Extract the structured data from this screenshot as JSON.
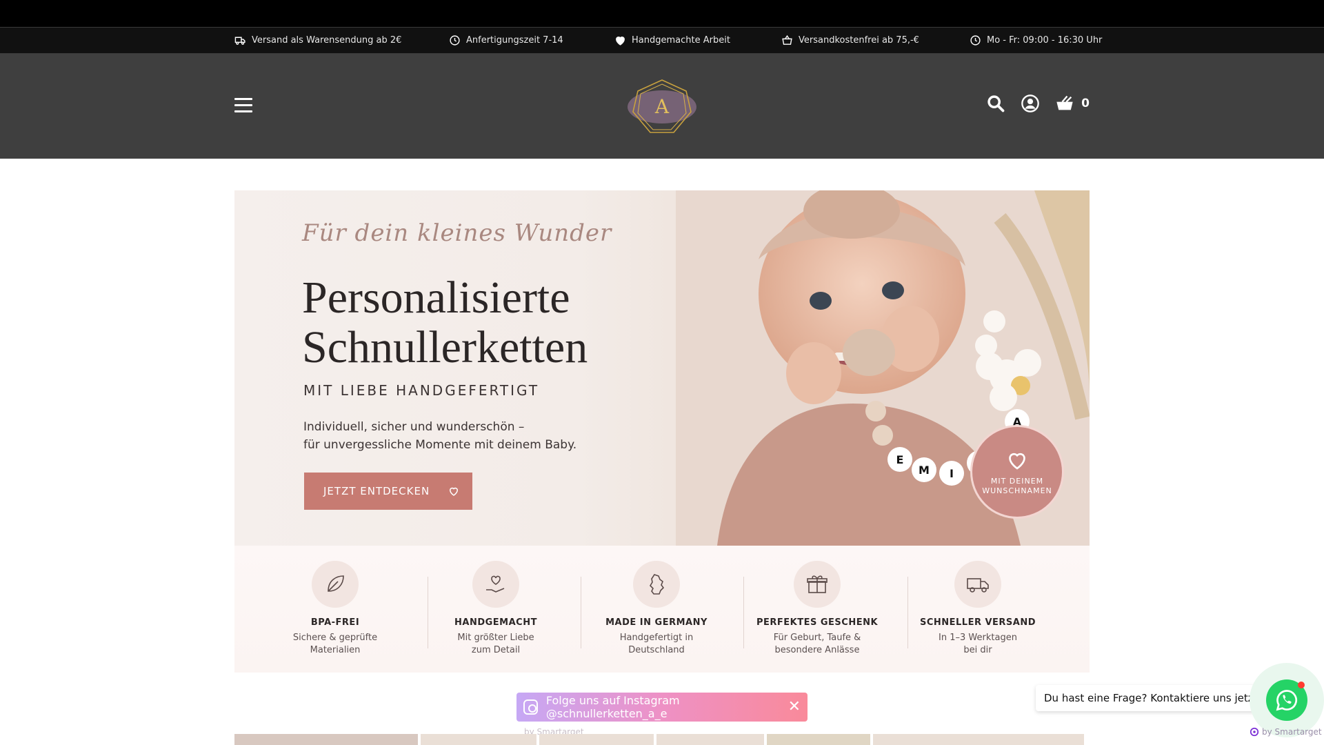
{
  "infobar": {
    "items": [
      {
        "icon": "truck-icon",
        "label": "Versand als Warensendung ab 2€"
      },
      {
        "icon": "clock-icon",
        "label": "Anfertigungszeit 7-14"
      },
      {
        "icon": "heart-icon",
        "label": "Handgemachte Arbeit"
      },
      {
        "icon": "basket-icon",
        "label": "Versandkostenfrei ab 75,-€"
      },
      {
        "icon": "clock-icon",
        "label": "Mo - Fr: 09:00 - 16:30 Uhr"
      }
    ]
  },
  "header": {
    "logo_text": "A",
    "cart_count": "0"
  },
  "hero": {
    "script_text": "Für dein kleines Wunder",
    "title_line1": "Personalisierte",
    "title_line2": "Schnullerketten",
    "subtitle": "MIT LIEBE HANDGEFERTIGT",
    "text_line1": "Individuell, sicher und wunderschön –",
    "text_line2": "für unvergessliche Momente mit deinem Baby.",
    "cta_label": "JETZT ENTDECKEN",
    "badge_line1": "MIT DEINEM",
    "badge_line2": "WUNSCHNAMEN",
    "chain_name": "EMILIA"
  },
  "features": [
    {
      "title": "BPA-FREI",
      "line1": "Sichere & geprüfte",
      "line2": "Materialien"
    },
    {
      "title": "HANDGEMACHT",
      "line1": "Mit größter Liebe",
      "line2": "zum Detail"
    },
    {
      "title": "MADE IN GERMANY",
      "line1": "Handgefertigt in",
      "line2": "Deutschland"
    },
    {
      "title": "PERFEKTES GESCHENK",
      "line1": "Für Geburt, Taufe &",
      "line2": "besondere Anlässe"
    },
    {
      "title": "SCHNELLER VERSAND",
      "line1": "In 1–3 Werktagen",
      "line2": "bei dir"
    }
  ],
  "instagram": {
    "label": "Folge uns auf Instagram @schnullerketten_a_e",
    "by": "by Smartarget"
  },
  "chat": {
    "bubble": "Du hast eine Frage? Kontaktiere uns jetzt",
    "by": "by Smartarget"
  },
  "colors": {
    "accent": "#c77b72",
    "header_bg": "#3f3f3f",
    "whatsapp": "#25d366"
  }
}
